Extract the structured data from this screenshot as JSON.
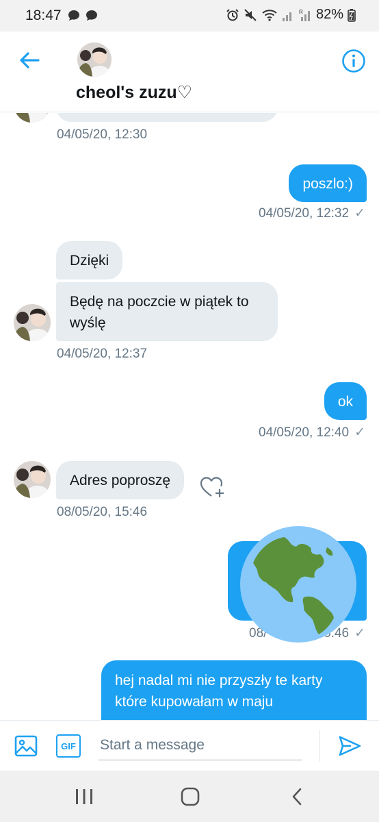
{
  "status_bar": {
    "time": "18:47",
    "battery": "82%"
  },
  "header": {
    "contact_name": "cheol's zuzu♡"
  },
  "messages": [
    {
      "side": "received",
      "text": "",
      "time": "04/05/20, 12:30"
    },
    {
      "side": "sent",
      "text": "poszlo:)",
      "time": "04/05/20, 12:32"
    },
    {
      "side": "received",
      "text": "Dzięki"
    },
    {
      "side": "received",
      "text": "Będę na poczcie w piątek to wyślę",
      "time": "04/05/20, 12:37"
    },
    {
      "side": "sent",
      "text": "ok",
      "time": "04/05/20, 12:40"
    },
    {
      "side": "received",
      "text": "Adres poproszę",
      "time": "08/05/20, 15:46"
    },
    {
      "side": "sent",
      "text": "",
      "time_visible_prefix": "08/",
      "time_visible_suffix": "5:46",
      "obscured_by": "globe-icon"
    },
    {
      "side": "sent",
      "text": "hej nadal mi nie przyszły te karty które kupowałam w maju"
    }
  ],
  "composer": {
    "placeholder": "Start a message",
    "gif_label": "GIF"
  },
  "colors": {
    "accent": "#1da1f2",
    "received_bubble": "#e6ecf0",
    "timestamp": "#657786"
  }
}
